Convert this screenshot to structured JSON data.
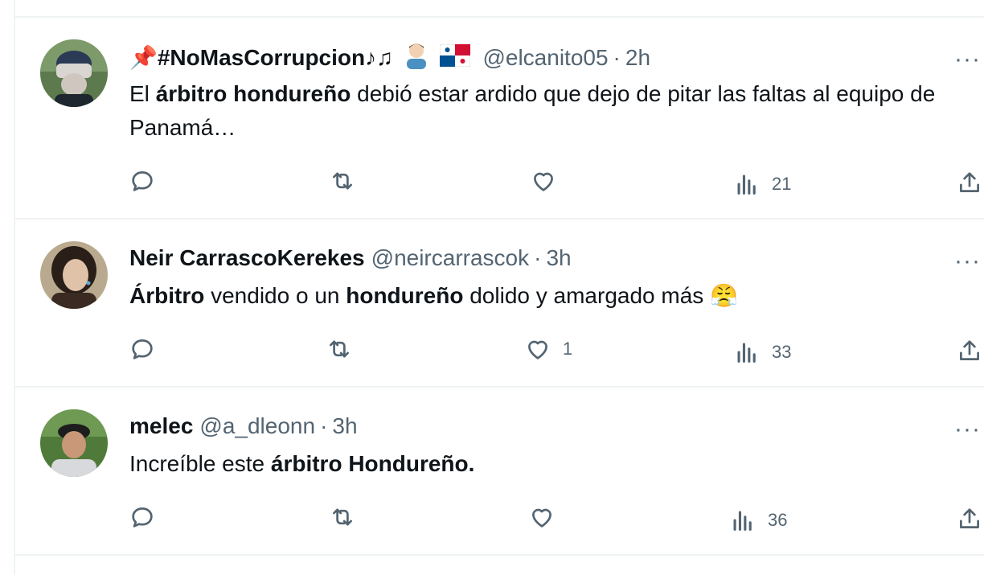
{
  "tweets": [
    {
      "name": "📌#NoMasCorrupcion♪♫",
      "handle": "@elcanito05",
      "separator": "·",
      "time": "2h",
      "body": [
        {
          "text": "El ",
          "bold": false
        },
        {
          "text": "árbitro hondureño",
          "bold": true
        },
        {
          "text": " debió estar ardido que dejo de pitar las faltas al equipo de Panamá…",
          "bold": false
        }
      ],
      "reply_count": "",
      "retweet_count": "",
      "like_count": "",
      "view_count": "21",
      "avatar_colors": {
        "bg": "#5d7a4e",
        "face": "#cfc7bf",
        "hair": "#2b3a55"
      }
    },
    {
      "name": "Neir CarrascoKerekes",
      "handle": "@neircarrascok",
      "separator": "·",
      "time": "3h",
      "body": [
        {
          "text": "Árbitro",
          "bold": true
        },
        {
          "text": " vendido o un ",
          "bold": false
        },
        {
          "text": "hondureño",
          "bold": true
        },
        {
          "text": " dolido y amargado más ",
          "bold": false
        },
        {
          "text": "😤",
          "bold": false
        }
      ],
      "reply_count": "",
      "retweet_count": "",
      "like_count": "1",
      "view_count": "33",
      "avatar_colors": {
        "bg": "#b9a98e",
        "face": "#e0c2a8",
        "hair": "#2a1e19"
      }
    },
    {
      "name": "melec",
      "handle": "@a_dleonn",
      "separator": "·",
      "time": "3h",
      "body": [
        {
          "text": "Increíble este ",
          "bold": false
        },
        {
          "text": "árbitro Hondureño.",
          "bold": true
        }
      ],
      "reply_count": "",
      "retweet_count": "",
      "like_count": "",
      "view_count": "36",
      "avatar_colors": {
        "bg": "#4f7a3a",
        "face": "#c89878",
        "hair": "#1d1d1d"
      }
    }
  ],
  "more_label": "···",
  "icons": [
    "reply-icon",
    "retweet-icon",
    "like-icon",
    "views-icon",
    "share-icon",
    "more-icon"
  ],
  "colors": {
    "text": "#0f1419",
    "muted": "#536471",
    "divider": "#eff3f4"
  }
}
